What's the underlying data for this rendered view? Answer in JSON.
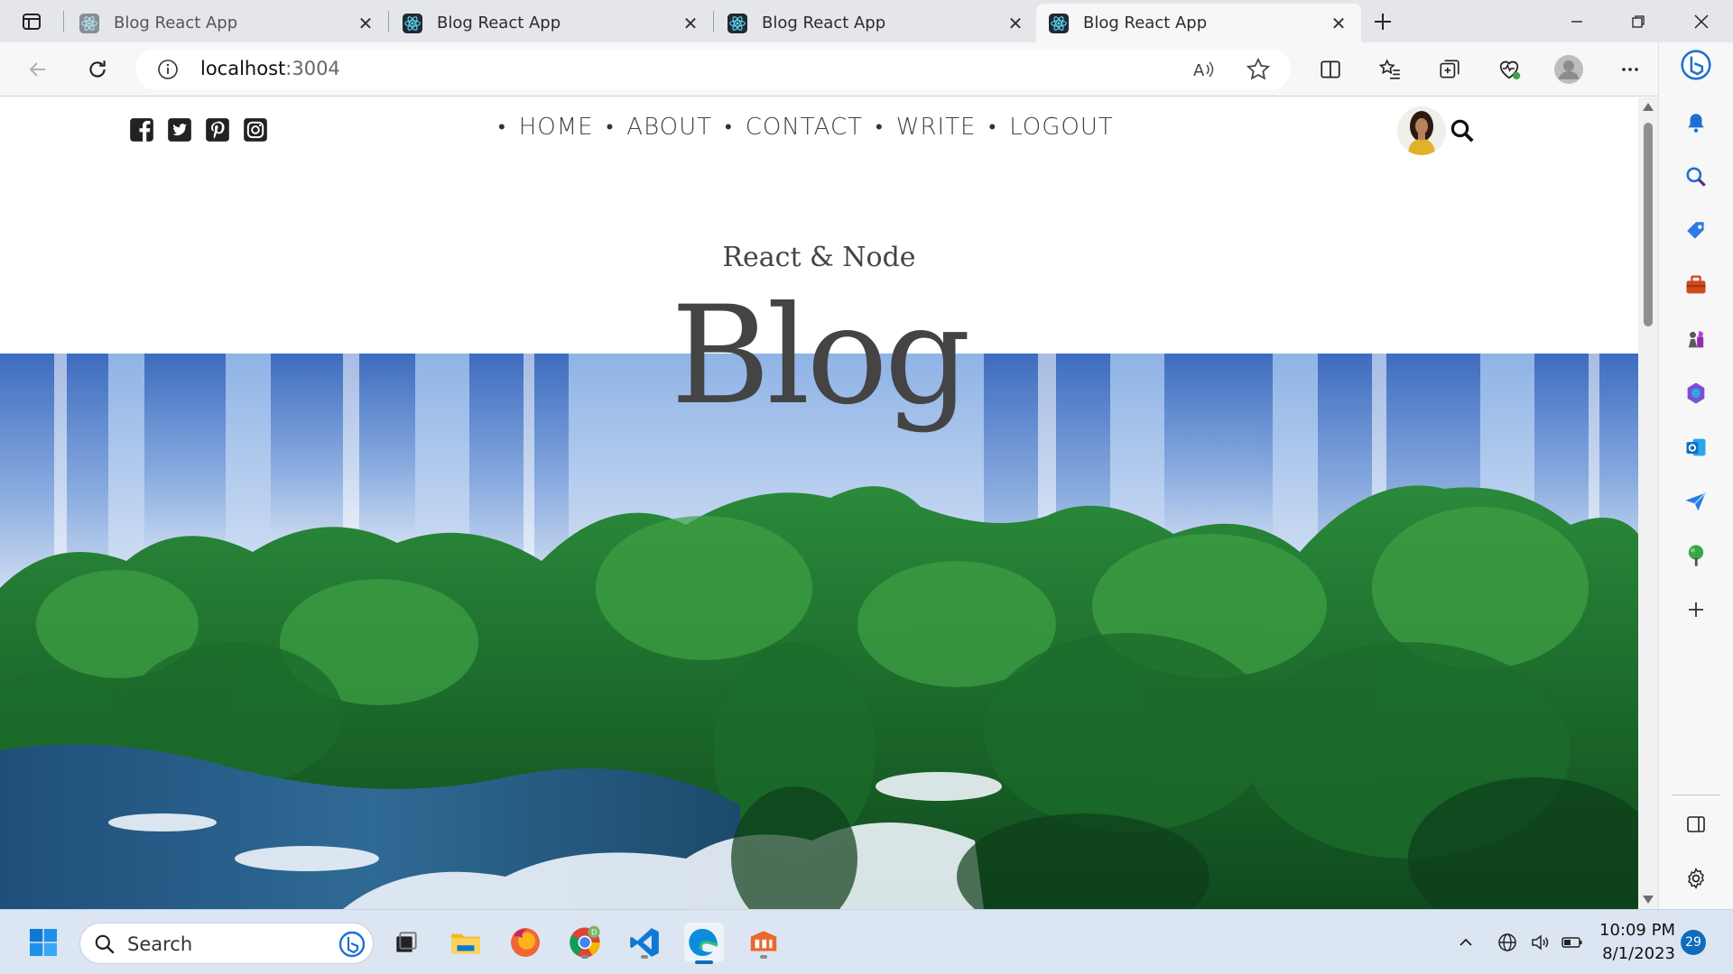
{
  "browser": {
    "tabs": [
      {
        "title": "Blog React App",
        "active": false
      },
      {
        "title": "Blog React App",
        "active": false
      },
      {
        "title": "Blog React App",
        "active": false
      },
      {
        "title": "Blog React App",
        "active": true
      }
    ],
    "address": {
      "host": "localhost",
      "port": ":3004"
    },
    "read_aloud_label": "Â"
  },
  "site": {
    "nav": {
      "items": [
        "HOME",
        "ABOUT",
        "CONTACT",
        "WRITE",
        "LOGOUT"
      ]
    },
    "social_icons": [
      "facebook-icon",
      "twitter-icon",
      "pinterest-icon",
      "instagram-icon"
    ],
    "header": {
      "subtitle": "React & Node",
      "title": "Blog"
    },
    "accent": "#444444"
  },
  "taskbar": {
    "search_label": "Search",
    "time": "10:09 PM",
    "date": "8/1/2023",
    "notification_count": "29",
    "chrome_badge": "D"
  }
}
